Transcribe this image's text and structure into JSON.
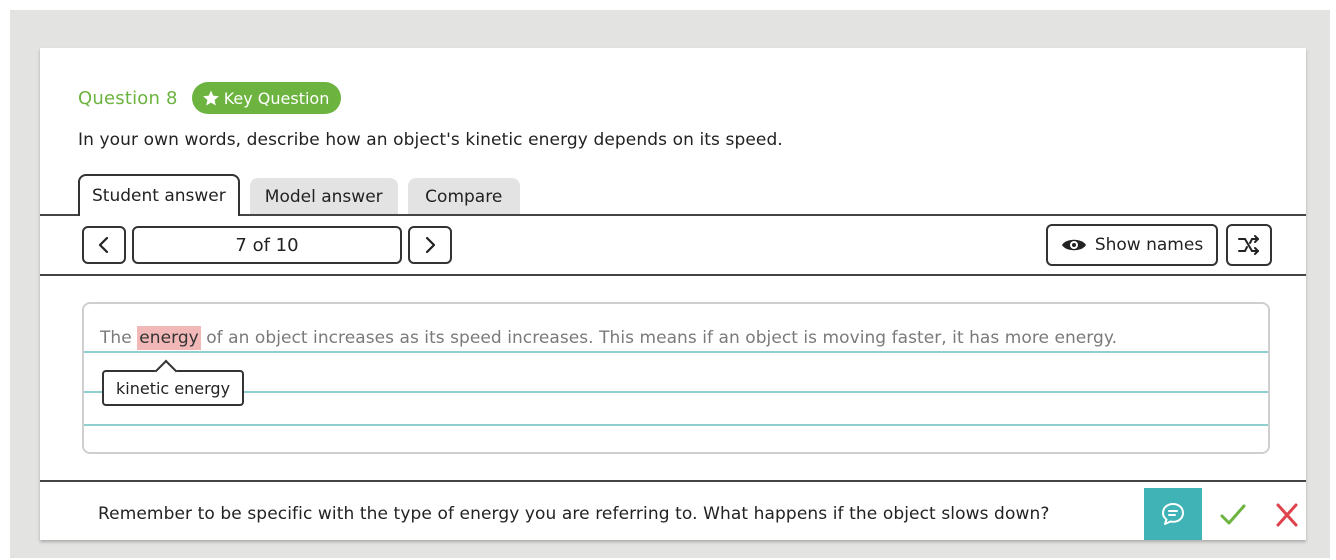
{
  "question": {
    "number_label": "Question 8",
    "badge_label": "Key Question",
    "prompt": "In your own words, describe how an object's kinetic energy depends on its speed."
  },
  "tabs": [
    {
      "label": "Student answer",
      "active": true
    },
    {
      "label": "Model answer",
      "active": false
    },
    {
      "label": "Compare",
      "active": false
    }
  ],
  "navigation": {
    "page_label": "7 of 10",
    "show_names_label": "Show names"
  },
  "answer": {
    "before": "The ",
    "highlight": "energy",
    "after": " of an object increases as its speed increases. This means if an object is moving faster, it has more energy.",
    "tooltip": "kinetic energy"
  },
  "feedback": {
    "text": "Remember to be specific with the type of energy you are referring to. What happens if the object slows down?"
  },
  "colors": {
    "brand_green": "#6cb33f",
    "highlight": "#f2b8b8",
    "teal": "#3fb3b5",
    "check": "#6cb33f",
    "cross": "#e0424c"
  },
  "icons": [
    "star-icon",
    "chevron-left-icon",
    "chevron-right-icon",
    "eye-icon",
    "shuffle-icon",
    "comment-icon",
    "check-icon",
    "cross-icon"
  ]
}
